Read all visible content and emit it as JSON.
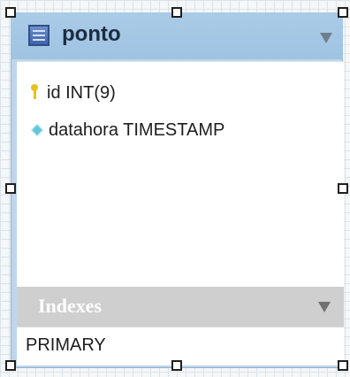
{
  "table": {
    "name": "ponto",
    "columns": [
      {
        "label": "id INT(9)",
        "icon": "primary-key-icon"
      },
      {
        "label": "datahora TIMESTAMP",
        "icon": "column-diamond-icon"
      }
    ],
    "indexes_header": "Indexes",
    "indexes": [
      {
        "label": "PRIMARY"
      }
    ]
  },
  "icons": {
    "table_icon": "table-icon",
    "header_expand": "chevron-down-icon",
    "indexes_expand": "chevron-down-icon"
  },
  "colors": {
    "header_blue": "#aacbe7",
    "frame_blue": "#bfd6ea",
    "title_text": "#1d2b42",
    "index_header_gray": "#cfcfcf",
    "key_yellow": "#e6c31f",
    "diamond_cyan": "#65c6d6"
  }
}
